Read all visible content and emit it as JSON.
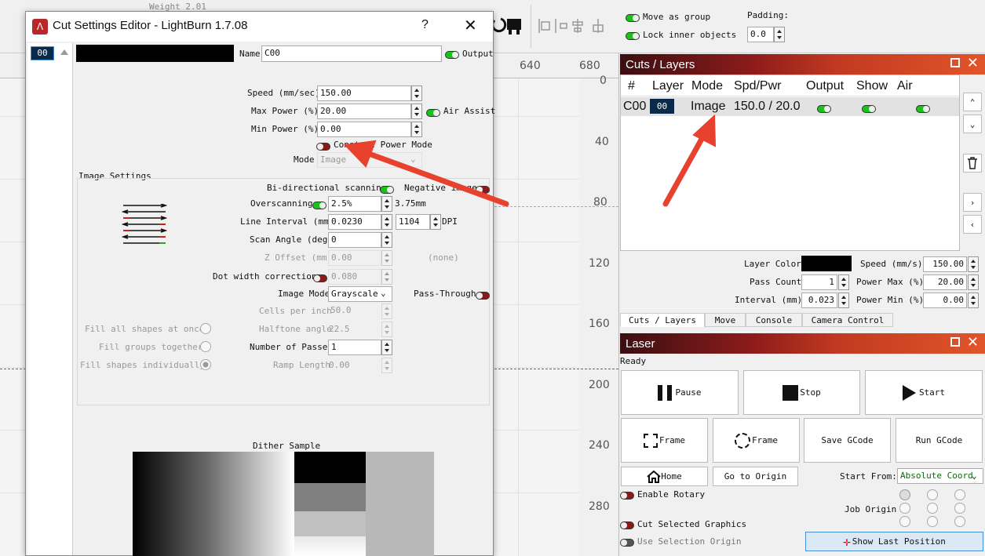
{
  "toolbar": {
    "weight_label": "Weight 2.01",
    "move_as_group": "Move as group",
    "lock_inner_objects": "Lock inner objects",
    "padding_label": "Padding:",
    "padding_value": "0.0"
  },
  "ruler": {
    "top": [
      "640",
      "680"
    ],
    "side": [
      "0",
      "40",
      "80",
      "120",
      "160",
      "200",
      "240",
      "280"
    ]
  },
  "dialog": {
    "title": "Cut Settings Editor - LightBurn 1.7.08",
    "help": "?",
    "layer_index": "00",
    "name_label": "Name",
    "name_value": "C00",
    "output_label": "Output",
    "speed_label": "Speed (mm/sec)",
    "speed_value": "150.00",
    "max_power_label": "Max Power (%)",
    "max_power_value": "20.00",
    "air_assist_label": "Air Assist",
    "min_power_label": "Min Power (%)",
    "min_power_value": "0.00",
    "constant_power_label": "Constant Power Mode",
    "mode_label": "Mode",
    "mode_value": "Image",
    "image_settings_label": "Image Settings",
    "bidir_label": "Bi-directional scanning",
    "negative_label": "Negative image",
    "overscan_label": "Overscanning",
    "overscan_value": "2.5%",
    "overscan_mm": "3.75mm",
    "line_interval_label": "Line Interval (mm)",
    "line_interval_value": "0.0230",
    "dpi_value": "1104",
    "dpi_label": "DPI",
    "scan_angle_label": "Scan Angle (deg)",
    "scan_angle_value": "0",
    "z_offset_label": "Z Offset (mm)",
    "z_offset_value": "0.00",
    "none_label": "(none)",
    "dot_width_label": "Dot width correction",
    "dot_width_value": "0.080",
    "image_mode_label": "Image Mode",
    "image_mode_value": "Grayscale",
    "pass_through_label": "Pass-Through",
    "cells_label": "Cells per inch",
    "cells_value": "50.0",
    "halftone_label": "Halftone angle",
    "halftone_value": "22.5",
    "passes_label": "Number of Passes",
    "passes_value": "1",
    "ramp_label": "Ramp Length",
    "ramp_value": "0.00",
    "fill_all_label": "Fill all shapes at once",
    "fill_groups_label": "Fill groups together",
    "fill_individually_label": "Fill shapes individually",
    "dither_label": "Dither Sample"
  },
  "cuts_layers": {
    "title": "Cuts / Layers",
    "columns": [
      "#",
      "Layer",
      "Mode",
      "Spd/Pwr",
      "Output",
      "Show",
      "Air"
    ],
    "row": {
      "id": "C00",
      "layer": "00",
      "mode": "Image",
      "spd_pwr": "150.0 / 20.0"
    },
    "layer_color_label": "Layer Color",
    "speed_label": "Speed (mm/s)",
    "speed_value": "150.00",
    "pass_count_label": "Pass Count",
    "pass_count_value": "1",
    "power_max_label": "Power Max (%)",
    "power_max_value": "20.00",
    "interval_label": "Interval (mm)",
    "interval_value": "0.023",
    "power_min_label": "Power Min (%)",
    "power_min_value": "0.00",
    "tabs": [
      "Cuts / Layers",
      "Move",
      "Console",
      "Camera Control"
    ]
  },
  "laser": {
    "title": "Laser",
    "status": "Ready",
    "pause": "Pause",
    "stop": "Stop",
    "start": "Start",
    "frame1": "Frame",
    "frame2": "Frame",
    "save_gcode": "Save GCode",
    "run_gcode": "Run GCode",
    "home": "Home",
    "go_to_origin": "Go to Origin",
    "start_from_label": "Start From:",
    "start_from_value": "Absolute Coord",
    "enable_rotary": "Enable Rotary",
    "job_origin": "Job Origin",
    "cut_selected": "Cut Selected Graphics",
    "use_selection_origin": "Use Selection Origin",
    "show_last_position": "Show Last Position"
  },
  "colors": {
    "accent": "#c23a21",
    "toggle_on": "#19c319",
    "toggle_off": "#8a1a1a",
    "arrow": "#e8412e",
    "selected_layer": "#0a2a4a"
  }
}
